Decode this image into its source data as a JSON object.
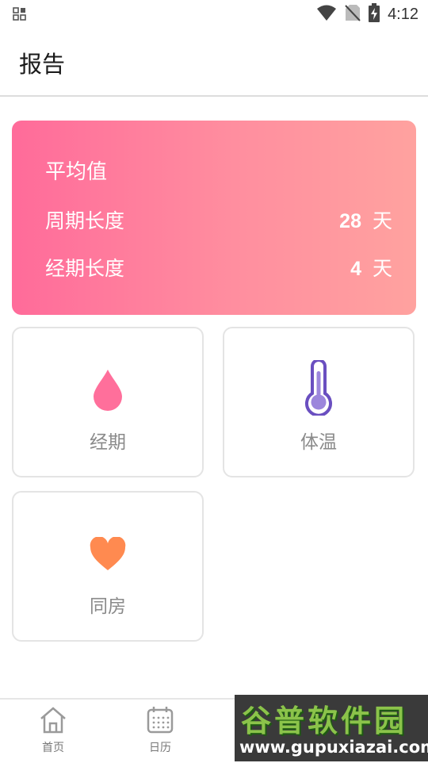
{
  "status_bar": {
    "time": "4:12"
  },
  "app_bar": {
    "title": "报告"
  },
  "average_card": {
    "title": "平均值",
    "rows": [
      {
        "label": "周期长度",
        "value": "28",
        "unit": "天"
      },
      {
        "label": "经期长度",
        "value": "4",
        "unit": "天"
      }
    ]
  },
  "tiles": [
    {
      "label": "经期",
      "icon": "drop-icon",
      "color": "#ff6f9b"
    },
    {
      "label": "体温",
      "icon": "thermometer-icon",
      "color": "#7b5cc8"
    },
    {
      "label": "同房",
      "icon": "heart-icon",
      "color": "#ff8a50"
    }
  ],
  "bottom_nav": {
    "items": [
      {
        "label": "首页",
        "icon": "home-icon"
      },
      {
        "label": "日历",
        "icon": "calendar-icon"
      }
    ]
  },
  "watermark": {
    "brand": "谷普软件园",
    "url": "www.gupuxiazai.com"
  }
}
